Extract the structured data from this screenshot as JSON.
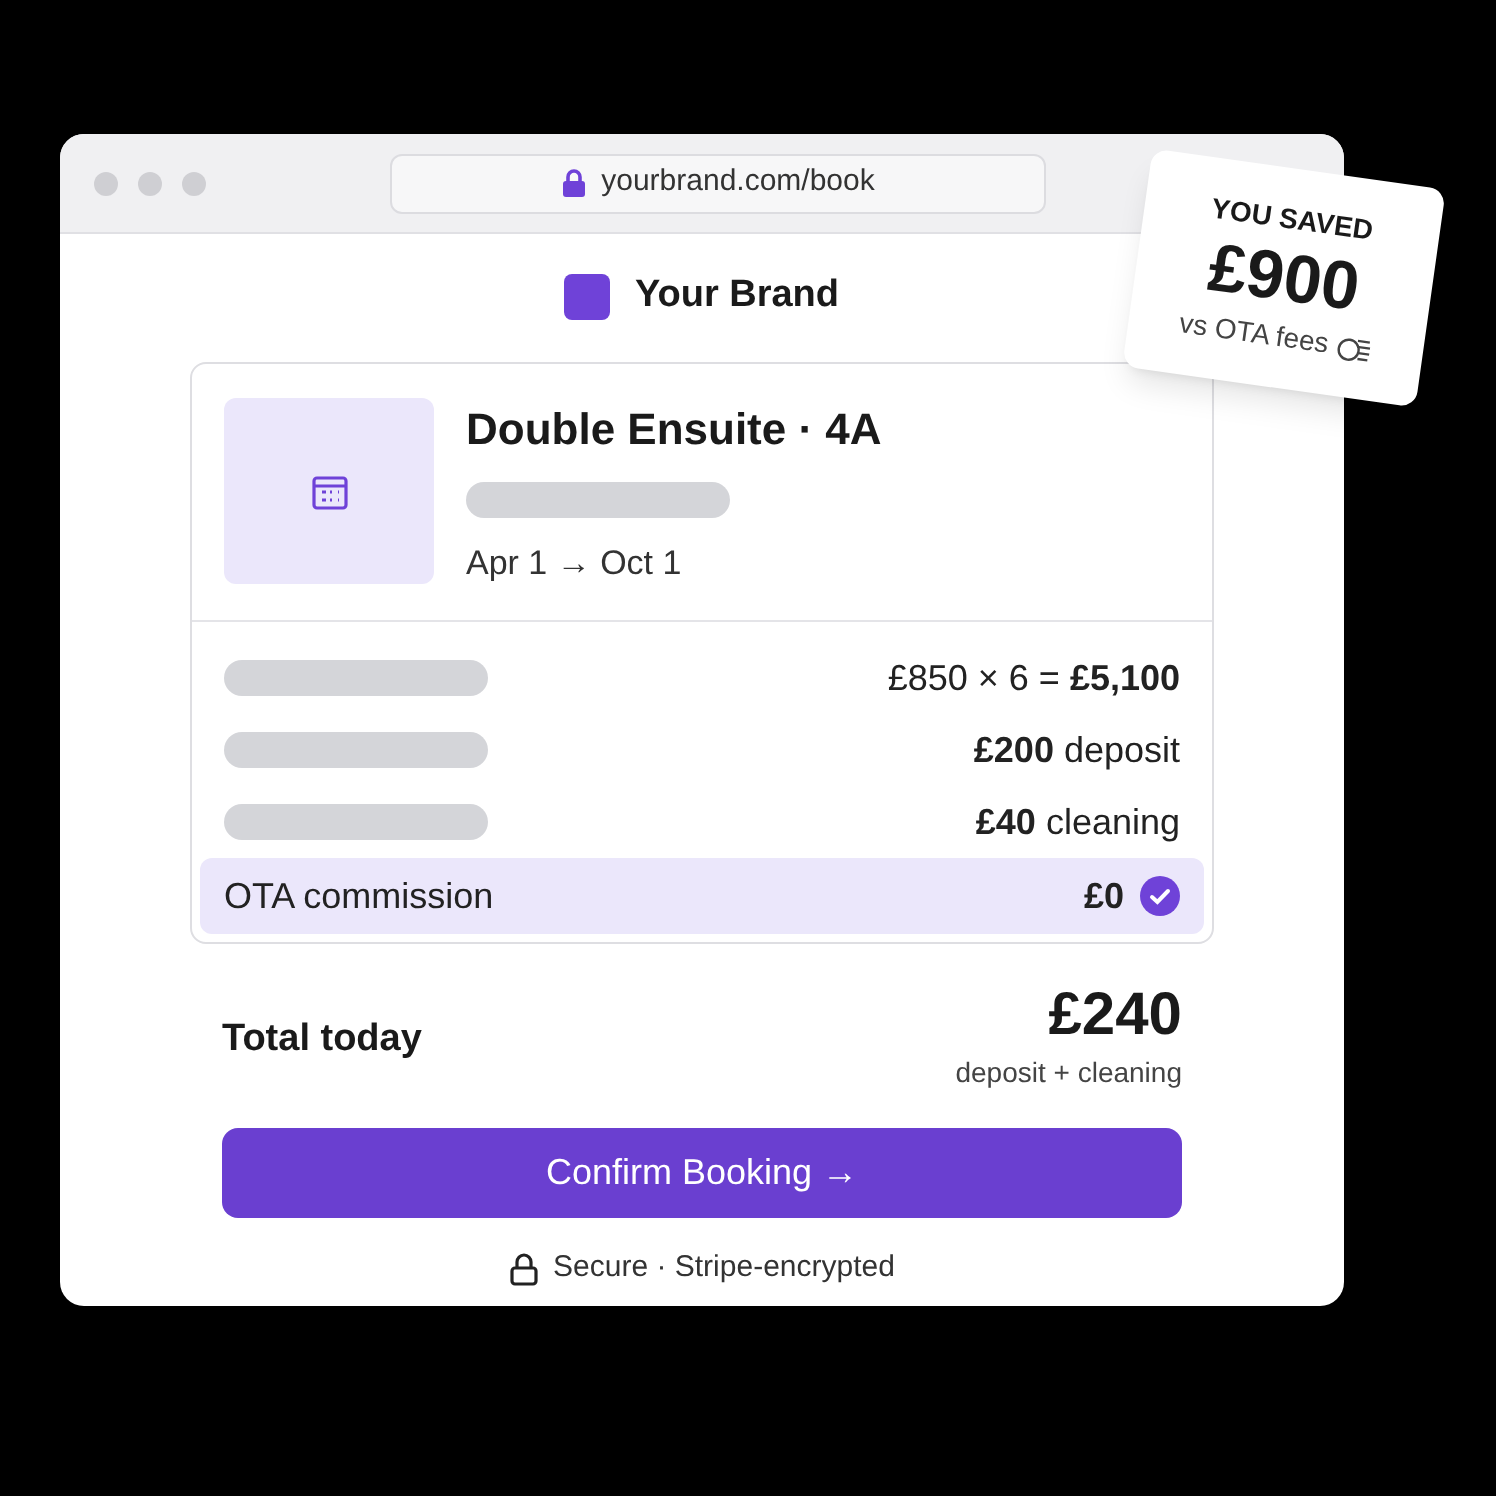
{
  "browser": {
    "url": "yourbrand.com/book"
  },
  "brand": {
    "name": "Your Brand"
  },
  "listing": {
    "title": "Double Ensuite · 4A",
    "dates": "Apr 1 → Oct 1"
  },
  "line_items": [
    {
      "kind": "charge",
      "amount": "£850 × 6 = **£5,100**"
    },
    {
      "kind": "charge",
      "amount": "**£200** deposit"
    },
    {
      "kind": "charge",
      "amount": "**£40** cleaning"
    },
    {
      "kind": "waived",
      "label": "OTA commission",
      "amount": "**£0**"
    }
  ],
  "total": {
    "label": "Total today",
    "amount": "£240",
    "note": "deposit + cleaning"
  },
  "confirm_button": {
    "label": "Confirm Booking →"
  },
  "security_note": "Secure · Stripe-encrypted",
  "savings_badge": {
    "heading": "YOU SAVED",
    "amount": "£900",
    "note": "vs OTA fees"
  }
}
